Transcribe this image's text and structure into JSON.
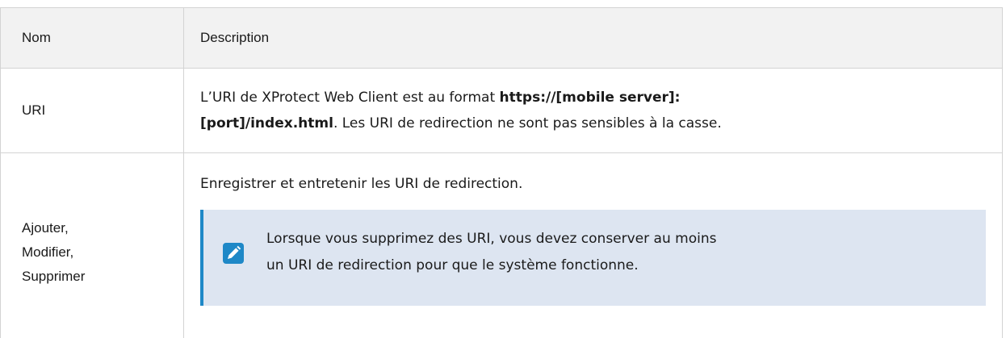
{
  "table": {
    "headers": {
      "name": "Nom",
      "description": "Description"
    },
    "rows": [
      {
        "name": "URI",
        "description": {
          "before": "L’URI de XProtect Web Client est au format ",
          "bold1": "https://[mobile server]:",
          "bold2": "[port]/index.html",
          "after": ". Les URI de redirection ne sont pas sensibles à la casse."
        }
      },
      {
        "name": {
          "part1": "Ajouter",
          "sep1": ",",
          "part2": "Modifier",
          "sep2": ",",
          "part3": "Supprimer"
        },
        "description": "Enregistrer et entretenir les URI de redirection.",
        "note": {
          "icon": "pencil-icon",
          "line1": "Lorsque vous supprimez des URI, vous devez conserver au moins",
          "line2": "un URI de redirection pour que le système fonctionne."
        }
      }
    ]
  },
  "colors": {
    "header_bg": "#f2f2f2",
    "border": "#d3d3d3",
    "note_bg": "#dde5f1",
    "accent": "#1e88c7"
  }
}
